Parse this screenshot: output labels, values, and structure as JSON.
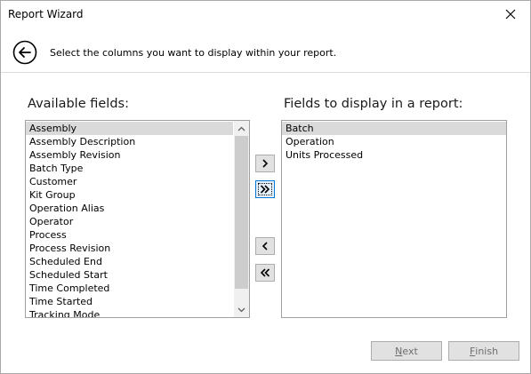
{
  "window": {
    "title": "Report Wizard"
  },
  "header": {
    "instructions": "Select the columns you want to display within your report."
  },
  "available": {
    "label": "Available fields:",
    "items": [
      {
        "label": "Assembly",
        "selected": true
      },
      {
        "label": "Assembly Description",
        "selected": false
      },
      {
        "label": "Assembly Revision",
        "selected": false
      },
      {
        "label": "Batch Type",
        "selected": false
      },
      {
        "label": "Customer",
        "selected": false
      },
      {
        "label": "Kit Group",
        "selected": false
      },
      {
        "label": "Operation Alias",
        "selected": false
      },
      {
        "label": "Operator",
        "selected": false
      },
      {
        "label": "Process",
        "selected": false
      },
      {
        "label": "Process Revision",
        "selected": false
      },
      {
        "label": "Scheduled End",
        "selected": false
      },
      {
        "label": "Scheduled Start",
        "selected": false
      },
      {
        "label": "Time Completed",
        "selected": false
      },
      {
        "label": "Time Started",
        "selected": false
      },
      {
        "label": "Tracking Mode",
        "selected": false
      }
    ]
  },
  "display": {
    "label": "Fields to display in a report:",
    "items": [
      {
        "label": "Batch",
        "selected": true
      },
      {
        "label": "Operation",
        "selected": false
      },
      {
        "label": "Units Processed",
        "selected": false
      }
    ]
  },
  "buttons": {
    "next_mnemonic": "N",
    "next_rest": "ext",
    "finish_mnemonic": "F",
    "finish_rest": "inish"
  },
  "icons": {
    "close": "close-icon",
    "back": "back-arrow-icon",
    "add": "chevron-right-icon",
    "add_all": "double-chevron-right-icon",
    "remove": "chevron-left-icon",
    "remove_all": "double-chevron-left-icon"
  },
  "colors": {
    "selection": "#dadada",
    "focus_border": "#0078d7"
  }
}
